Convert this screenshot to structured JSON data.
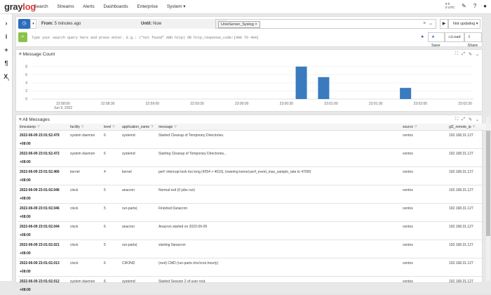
{
  "app": {
    "logo_prefix": "gray",
    "logo_suffix": "log"
  },
  "nav": [
    "Search",
    "Streams",
    "Alerts",
    "Dashboards",
    "Enterprise",
    "System ▾"
  ],
  "header_right": {
    "tz_line1": "9 h",
    "tz_line2": "0 UTC"
  },
  "search": {
    "from_label": "From:",
    "from_value": "5 minutes ago",
    "until_label": "Until:",
    "until_value": "Now",
    "stream_chip": "UnixServer_Syslog",
    "refresh_label": "Not updating",
    "query_placeholder": "Type your search query here and press enter. E.g.: (\"not found\" AND http) OR http_response_code:[400 TO 404]",
    "save_label": "Save",
    "load_label": "Load",
    "share_label": "Share"
  },
  "message_count": {
    "title": "Message Count"
  },
  "chart_data": {
    "type": "bar",
    "title": "Message Count",
    "y_ticks": [
      "8",
      "6",
      "4",
      "2",
      "0"
    ],
    "ylim": [
      0,
      9
    ],
    "x_ticks": [
      "22:58:00",
      "22:58:30",
      "22:59:00",
      "22:59:30",
      "23:00:00",
      "23:00:30",
      "23:01:00",
      "23:01:30",
      "23:02:00",
      "23:02:30"
    ],
    "x_sublabel": "Jun 9, 2022",
    "bars": [
      {
        "x": "23:00:40",
        "value": 8
      },
      {
        "x": "23:00:55",
        "value": 5.4
      },
      {
        "x": "23:01:50",
        "value": 2.748
      }
    ],
    "grid": true,
    "color": "#3a7bbf"
  },
  "messages": {
    "title": "All Messages",
    "columns": [
      "timestamp",
      "facility",
      "level",
      "application_name",
      "message",
      "source",
      "gl2_remote_ip"
    ],
    "rows": [
      {
        "timestamp": "2022-06-09 23:01:52.479 +08:00",
        "facility": "system daemon",
        "level": "6",
        "app": "systemd",
        "message": "Started Cleanup of Temporary Directories.",
        "source": "centos",
        "ip": "192.168.31.127"
      },
      {
        "timestamp": "2022-06-09 23:01:52.472 +08:00",
        "facility": "system daemon",
        "level": "6",
        "app": "systemd",
        "message": "Starting Cleanup of Temporary Directories...",
        "source": "centos",
        "ip": "192.168.31.127"
      },
      {
        "timestamp": "2022-06-09 23:01:52.466 +08:00",
        "facility": "kernel",
        "level": "4",
        "app": "kernel",
        "message": "perf: interrupt took too long (4254 > 4016), lowering kernel.perf_event_max_sample_rate to 47000",
        "source": "centos",
        "ip": "192.168.31.127"
      },
      {
        "timestamp": "2022-06-09 23:01:02.046 +08:00",
        "facility": "clock",
        "level": "5",
        "app": "anacron",
        "message": "Normal exit (0 jobs run)",
        "source": "centos",
        "ip": "192.168.31.127"
      },
      {
        "timestamp": "2022-06-09 23:01:02.046 +08:00",
        "facility": "clock",
        "level": "5",
        "app": "run-parts(",
        "message": "Finished 0anacron",
        "source": "centos",
        "ip": "192.168.31.127"
      },
      {
        "timestamp": "2022-06-09 23:01:02.044 +08:00",
        "facility": "clock",
        "level": "6",
        "app": "anacron",
        "message": "Anacron started on 2022-06-09",
        "source": "centos",
        "ip": "192.168.31.127"
      },
      {
        "timestamp": "2022-06-09 23:01:02.021 +08:00",
        "facility": "clock",
        "level": "5",
        "app": "run-parts(",
        "message": "starting 0anacron",
        "source": "centos",
        "ip": "192.168.31.127"
      },
      {
        "timestamp": "2022-06-09 23:01:02.013 +08:00",
        "facility": "clock",
        "level": "6",
        "app": "CROND",
        "message": "(root) CMD (run-parts /etc/cron.hourly)",
        "source": "centos",
        "ip": "192.168.31.127"
      },
      {
        "timestamp": "2022-06-09 23:01:02.012 +08:00",
        "facility": "system daemon",
        "level": "6",
        "app": "systemd",
        "message": "Started Session 2 of user root.",
        "source": "centos",
        "ip": "192.168.31.127"
      }
    ]
  }
}
